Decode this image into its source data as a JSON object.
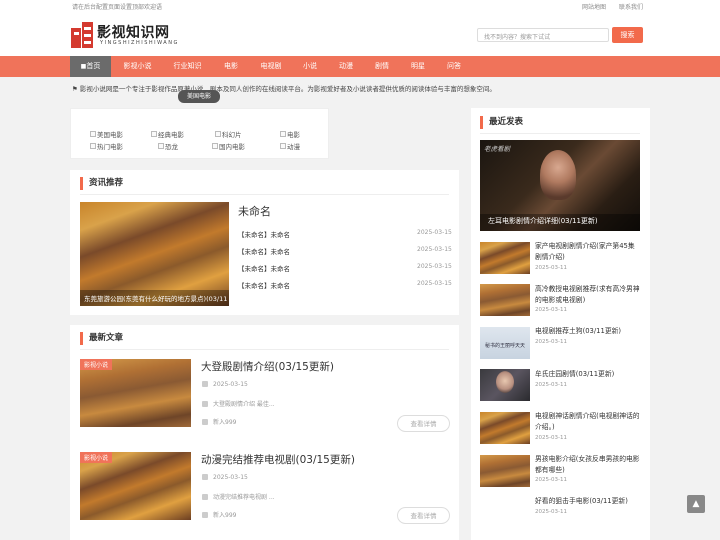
{
  "topbar": {
    "left_text": "请在后台配置页面设置顶部欢迎语",
    "home": "网站地图",
    "contact": "联系我们"
  },
  "logo": {
    "name": "影视知识网",
    "pinyin": "YINGSHIZHISHIWANG"
  },
  "search": {
    "placeholder": "找不到内容？搜索下试试",
    "button": "搜索"
  },
  "nav": [
    {
      "label": "首页",
      "active": true
    },
    {
      "label": "影视小说"
    },
    {
      "label": "行业知识"
    },
    {
      "label": "电影"
    },
    {
      "label": "电视剧"
    },
    {
      "label": "小说"
    },
    {
      "label": "动漫"
    },
    {
      "label": "剧情"
    },
    {
      "label": "明星"
    },
    {
      "label": "问答"
    }
  ],
  "notice": "影视小说网是一个专注于影视作品原著小说、剧本及同人创作的在线阅读平台。为影视爱好者及小说读者提供优质的阅读体验与丰富的想象空间。",
  "tooltip": "美国电影",
  "categories": [
    "美国电影",
    "经典电影",
    "科幻片",
    "电影",
    "热门电影",
    "恐龙",
    "国内电影",
    "动漫"
  ],
  "recommend": {
    "title": "资讯推荐",
    "feature_title": "未命名",
    "image_caption": "东莞旅游公园(东莞有什么好玩的地方景点)(03/11更新)",
    "items": [
      {
        "text": "【未命名】未命名",
        "date": "2025-03-15"
      },
      {
        "text": "【未命名】未命名",
        "date": "2025-03-15"
      },
      {
        "text": "【未命名】未命名",
        "date": "2025-03-15"
      },
      {
        "text": "【未命名】未命名",
        "date": "2025-03-15"
      }
    ]
  },
  "latest": {
    "title": "最新文章",
    "articles": [
      {
        "tag": "影视小说",
        "title": "大登殿剧情介绍(03/15更新)",
        "date": "2025-03-15",
        "summary": "大登殿剧情介绍 最佳...",
        "author": "新入999",
        "button": "查看详情"
      },
      {
        "tag": "影视小说",
        "title": "动漫完结推荐电视剧(03/15更新)",
        "date": "2025-03-15",
        "summary": "动漫完结推荐电视剧 ...",
        "author": "新入999",
        "button": "查看详情"
      }
    ]
  },
  "sidebar": {
    "title": "最近发表",
    "hero_caption": "左耳电影剧情介绍详细(03/11更新)",
    "hero_logo": "老虎看剧",
    "items": [
      {
        "title": "家产电视剧剧情介绍(家产第45集剧情介绍)",
        "date": "2025-03-11"
      },
      {
        "title": "高冷教授电视剧推荐(求有高冷男神的电影或电视剧)",
        "date": "2025-03-11"
      },
      {
        "title": "电视剧推荐土狗(03/11更新)",
        "date": "2025-03-11",
        "thumb_text": "秘书的王丽呼天天"
      },
      {
        "title": "牟氏庄园剧情(03/11更新)",
        "date": "2025-03-11"
      },
      {
        "title": "电视剧神话剧情介绍(电视剧神话的介绍。)",
        "date": "2025-03-11"
      },
      {
        "title": "男孩电影介绍(女孩反串男孩的电影都有哪些)",
        "date": "2025-03-11"
      },
      {
        "title": "好看的狙击手电影(03/11更新)",
        "date": "2025-03-11"
      }
    ]
  },
  "colors": {
    "accent": "#f0735a",
    "button": "#f26a4b"
  }
}
